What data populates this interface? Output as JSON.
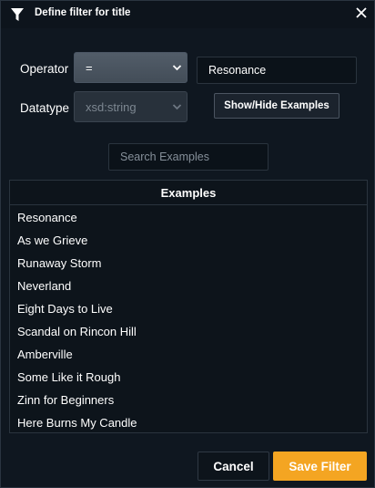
{
  "dialog": {
    "title": "Define filter for title",
    "icons": {
      "title": "filter-funnel-icon",
      "close": "close-x-icon"
    }
  },
  "operator": {
    "label": "Operator",
    "selected": "=",
    "value": "Resonance"
  },
  "datatype": {
    "label": "Datatype",
    "selected": "xsd:string",
    "disabled": true
  },
  "show_hide_label": "Show/Hide Examples",
  "search": {
    "placeholder": "Search Examples",
    "value": ""
  },
  "examples": {
    "header": "Examples",
    "items": [
      "Resonance",
      "As we Grieve",
      "Runaway Storm",
      "Neverland",
      "Eight Days to Live",
      "Scandal on Rincon Hill",
      "Amberville",
      "Some Like it Rough",
      "Zinn for Beginners",
      "Here Burns My Candle"
    ]
  },
  "footer": {
    "cancel_label": "Cancel",
    "save_label": "Save Filter"
  },
  "colors": {
    "accent": "#f4a522",
    "background": "#0f1720"
  }
}
